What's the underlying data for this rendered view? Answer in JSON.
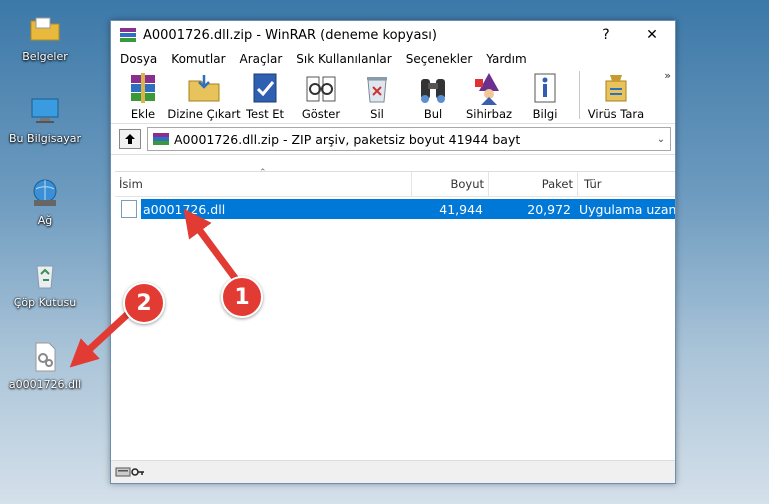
{
  "desktop": {
    "icons": [
      {
        "label": "Belgeler",
        "icon": "folder-icon"
      },
      {
        "label": "Bu Bilgisayar",
        "icon": "computer-icon"
      },
      {
        "label": "Ağ",
        "icon": "network-icon"
      },
      {
        "label": "Çöp Kutusu",
        "icon": "recycle-bin-icon"
      },
      {
        "label": "a0001726.dll",
        "icon": "dll-file-icon"
      }
    ]
  },
  "window": {
    "title": "A0001726.dll.zip - WinRAR (deneme kopyası)",
    "help_glyph": "?",
    "close_glyph": "✕",
    "menu": [
      "Dosya",
      "Komutlar",
      "Araçlar",
      "Sık Kullanılanlar",
      "Seçenekler",
      "Yardım"
    ],
    "toolbar": [
      {
        "label": "Ekle",
        "icon": "add-archive-icon"
      },
      {
        "label": "Dizine Çıkart",
        "icon": "extract-to-icon"
      },
      {
        "label": "Test Et",
        "icon": "test-icon"
      },
      {
        "label": "Göster",
        "icon": "view-icon"
      },
      {
        "label": "Sil",
        "icon": "delete-icon"
      },
      {
        "label": "Bul",
        "icon": "find-icon"
      },
      {
        "label": "Sihirbaz",
        "icon": "wizard-icon"
      },
      {
        "label": "Bilgi",
        "icon": "info-icon"
      },
      {
        "label": "Virüs Tara",
        "icon": "virus-scan-icon"
      }
    ],
    "toolbar_more": "»",
    "path_text": "A0001726.dll.zip - ZIP arşiv, paketsiz boyut 41944 bayt",
    "columns": {
      "name": "İsim",
      "size": "Boyut",
      "packed": "Paket",
      "type": "Tür"
    },
    "files": [
      {
        "name": "a0001726.dll",
        "size": "41,944",
        "packed": "20,972",
        "type": "Uygulama uzantısı"
      }
    ]
  },
  "annotations": [
    {
      "number": "1"
    },
    {
      "number": "2"
    }
  ],
  "colors": {
    "selection": "#0078d7",
    "badge": "#e23b34"
  }
}
